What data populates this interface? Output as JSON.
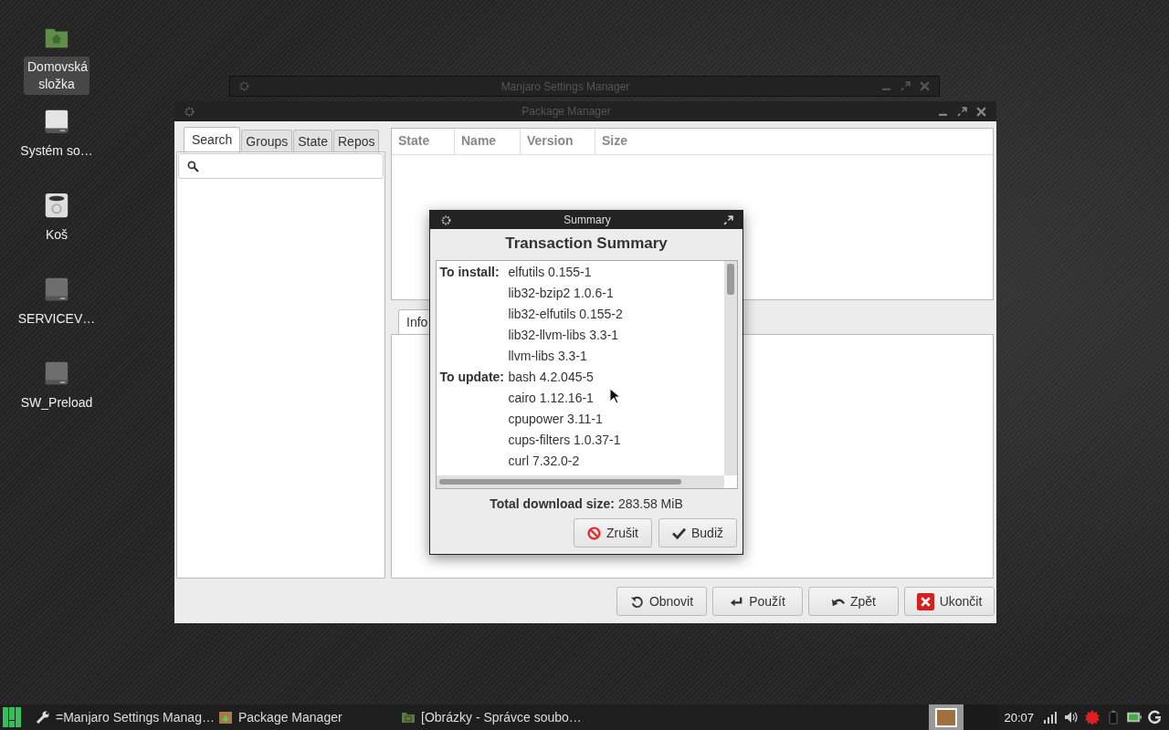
{
  "desktop_icons": [
    {
      "label": "Domovská složka",
      "kind": "home",
      "selected": true
    },
    {
      "label": "Systém so…",
      "kind": "drive",
      "selected": false
    },
    {
      "label": "Koš",
      "kind": "trash",
      "selected": false
    },
    {
      "label": "SERVICEV…",
      "kind": "drive_dim",
      "selected": false
    },
    {
      "label": "SW_Preload",
      "kind": "drive_dim",
      "selected": false
    }
  ],
  "back_window": {
    "title": "Manjaro Settings Manager"
  },
  "package_manager": {
    "title": "Package Manager",
    "tabs": [
      {
        "label": "Search",
        "selected": true
      },
      {
        "label": "Groups",
        "selected": false
      },
      {
        "label": "State",
        "selected": false
      },
      {
        "label": "Repos",
        "selected": false
      }
    ],
    "columns": [
      "State",
      "Name",
      "Version",
      "Size"
    ],
    "info_tab": {
      "label": "Info",
      "selected": true
    },
    "buttons": [
      {
        "label": "Obnovit",
        "kind": "refresh"
      },
      {
        "label": "Použít",
        "kind": "apply"
      },
      {
        "label": "Zpět",
        "kind": "undo"
      },
      {
        "label": "Ukončit",
        "kind": "quit"
      }
    ]
  },
  "summary": {
    "title": "Summary",
    "heading": "Transaction Summary",
    "groups": [
      {
        "label": "To install:",
        "items": [
          "elfutils 0.155-1",
          "lib32-bzip2 1.0.6-1",
          "lib32-elfutils 0.155-2",
          "lib32-llvm-libs 3.3-1",
          "llvm-libs 3.3-1"
        ]
      },
      {
        "label": "To update:",
        "items": [
          "bash 4.2.045-5",
          "cairo 1.12.16-1",
          "cpupower 3.11-1",
          "cups-filters 1.0.37-1",
          "curl 7.32.0-2"
        ]
      }
    ],
    "total_label": "Total download size:",
    "total_value": "283.58 MiB",
    "buttons": [
      {
        "label": "Zrušit",
        "kind": "cancel"
      },
      {
        "label": "Budiž",
        "kind": "ok"
      }
    ]
  },
  "taskbar": {
    "tasks": [
      {
        "label": "=Manjaro Settings Manag…",
        "kind": "wrench"
      },
      {
        "label": "Package Manager",
        "kind": "package"
      },
      {
        "label": "[Obrázky - Správce soubo…",
        "kind": "folder"
      }
    ],
    "workspaces": [
      {
        "selected": true
      },
      {
        "selected": false
      }
    ],
    "clock": "20:07"
  }
}
